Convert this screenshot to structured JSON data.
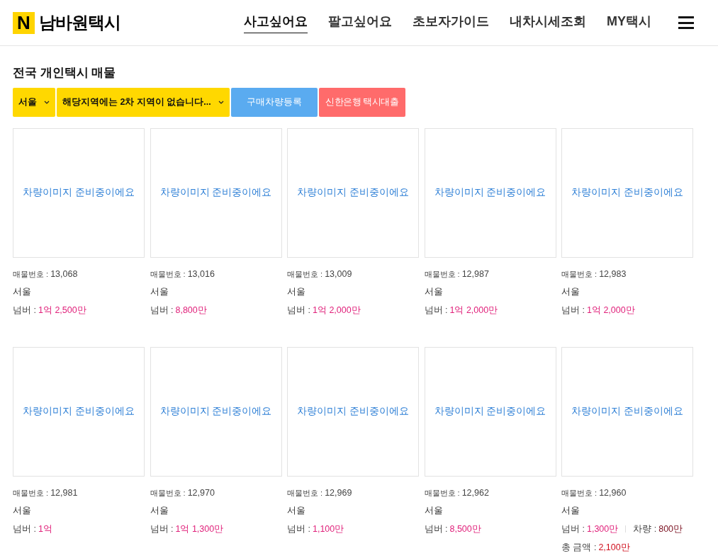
{
  "header": {
    "logo_mark": "N",
    "logo_text": "남바원택시",
    "nav": [
      {
        "label": "사고싶어요",
        "selected": true
      },
      {
        "label": "팔고싶어요",
        "selected": false
      },
      {
        "label": "초보자가이드",
        "selected": false
      },
      {
        "label": "내차시세조회",
        "selected": false
      },
      {
        "label": "MY택시",
        "selected": false
      }
    ]
  },
  "section_title": "전국 개인택시 매물",
  "filters": [
    {
      "kind": "select",
      "label": "서울"
    },
    {
      "kind": "select",
      "label": "해당지역에는 2차 지역이 없습니다..."
    },
    {
      "kind": "register",
      "label": "구매차량등록"
    },
    {
      "kind": "loan",
      "label": "신한은행 택시대출"
    }
  ],
  "listings": [
    {
      "image_placeholder": "차량이미지 준비중이에요",
      "id_label": "매물번호 :",
      "id": "13,068",
      "region": "서울",
      "price_lines": [
        [
          {
            "kind": "number",
            "label": "넘버 :",
            "value": "1억 2,500만"
          }
        ]
      ]
    },
    {
      "image_placeholder": "차량이미지 준비중이에요",
      "id_label": "매물번호 :",
      "id": "13,016",
      "region": "서울",
      "price_lines": [
        [
          {
            "kind": "number",
            "label": "넘버 :",
            "value": "8,800만"
          }
        ]
      ]
    },
    {
      "image_placeholder": "차량이미지 준비중이에요",
      "id_label": "매물번호 :",
      "id": "13,009",
      "region": "서울",
      "price_lines": [
        [
          {
            "kind": "number",
            "label": "넘버 :",
            "value": "1억 2,000만"
          }
        ]
      ]
    },
    {
      "image_placeholder": "차량이미지 준비중이에요",
      "id_label": "매물번호 :",
      "id": "12,987",
      "region": "서울",
      "price_lines": [
        [
          {
            "kind": "number",
            "label": "넘버 :",
            "value": "1억 2,000만"
          }
        ]
      ]
    },
    {
      "image_placeholder": "차량이미지 준비중이에요",
      "id_label": "매물번호 :",
      "id": "12,983",
      "region": "서울",
      "price_lines": [
        [
          {
            "kind": "number",
            "label": "넘버 :",
            "value": "1억 2,000만"
          }
        ]
      ]
    },
    {
      "image_placeholder": "차량이미지 준비중이에요",
      "id_label": "매물번호 :",
      "id": "12,981",
      "region": "서울",
      "price_lines": [
        [
          {
            "kind": "number",
            "label": "넘버 :",
            "value": "1억"
          }
        ]
      ]
    },
    {
      "image_placeholder": "차량이미지 준비중이에요",
      "id_label": "매물번호 :",
      "id": "12,970",
      "region": "서울",
      "price_lines": [
        [
          {
            "kind": "number",
            "label": "넘버 :",
            "value": "1억 1,300만"
          }
        ]
      ]
    },
    {
      "image_placeholder": "차량이미지 준비중이에요",
      "id_label": "매물번호 :",
      "id": "12,969",
      "region": "서울",
      "price_lines": [
        [
          {
            "kind": "number",
            "label": "넘버 :",
            "value": "1,100만"
          }
        ]
      ]
    },
    {
      "image_placeholder": "차량이미지 준비중이에요",
      "id_label": "매물번호 :",
      "id": "12,962",
      "region": "서울",
      "price_lines": [
        [
          {
            "kind": "number",
            "label": "넘버 :",
            "value": "8,500만"
          }
        ]
      ]
    },
    {
      "image_placeholder": "차량이미지 준비중이에요",
      "id_label": "매물번호 :",
      "id": "12,960",
      "region": "서울",
      "price_lines": [
        [
          {
            "kind": "number",
            "label": "넘버 :",
            "value": "1,300만"
          },
          {
            "kind": "car",
            "label": "차량 :",
            "value": "800만"
          }
        ],
        [
          {
            "kind": "total",
            "label": "총 금액 :",
            "value": "2,100만"
          }
        ]
      ]
    }
  ]
}
